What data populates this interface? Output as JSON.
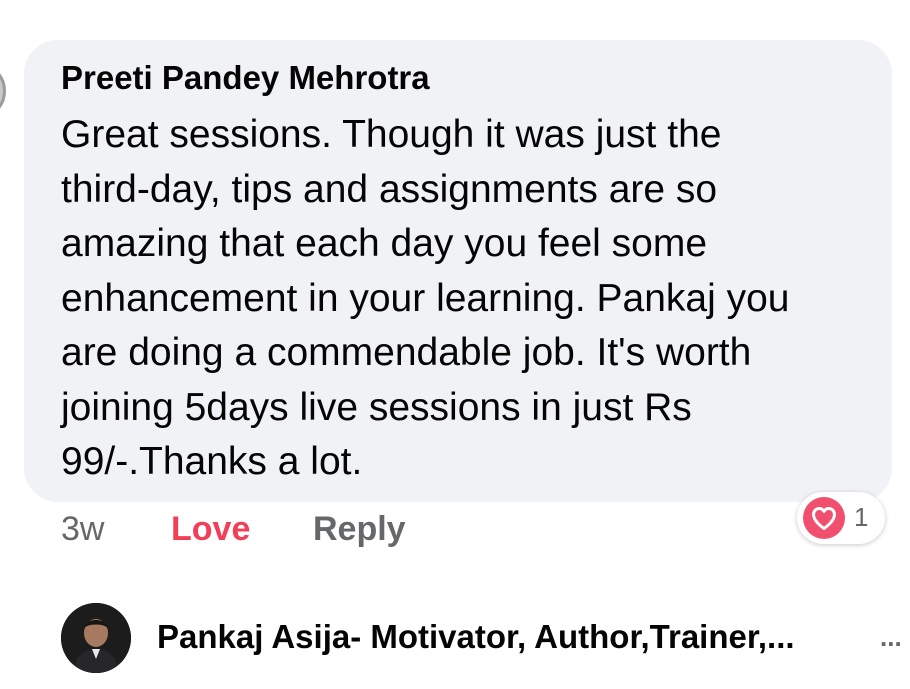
{
  "comment": {
    "author": "Preeti Pandey Mehrotra",
    "text": "Great sessions. Though it was just the\nthird-day, tips and assignments are so\namazing that each day you feel some\nenhancement in your learning. Pankaj you\nare doing a commendable job. It's worth\njoining 5days  live sessions in just Rs\n99/-.Thanks a lot.",
    "bubble_color": "#f0f2f5"
  },
  "actions": {
    "time": "3w",
    "love_label": "Love",
    "reply_label": "Reply",
    "love_color": "#f33e58"
  },
  "reaction": {
    "icon": "heart-icon",
    "count": "1",
    "color": "#f0506e"
  },
  "reply": {
    "author": "Pankaj Asija- Motivator, Author,Trainer,...",
    "more_label": "..."
  }
}
